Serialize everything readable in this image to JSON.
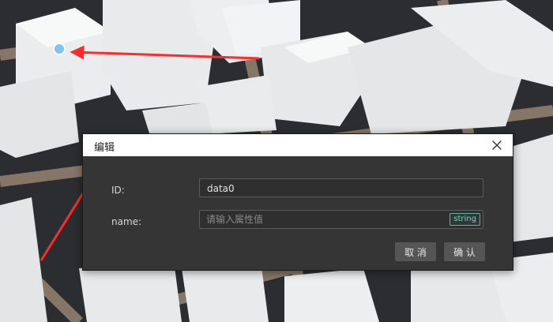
{
  "dialog": {
    "title": "编辑",
    "close_glyph": "×",
    "fields": [
      {
        "label": "ID:",
        "value": "data0"
      },
      {
        "label": "name:",
        "value": "",
        "placeholder": "请输入属性值",
        "type_badge": "string"
      }
    ],
    "buttons": {
      "cancel": "取 消",
      "confirm": "确 认"
    }
  },
  "colors": {
    "annotation_arrow": "#ff2b2b",
    "marker": "#7cc4f5",
    "road": "#8b7a6a",
    "building": "#e9ebec",
    "ground": "#2b2d30",
    "badge_accent": "#5fb3a3"
  },
  "icons": {
    "close": "close-icon",
    "marker": "location-marker-icon"
  }
}
